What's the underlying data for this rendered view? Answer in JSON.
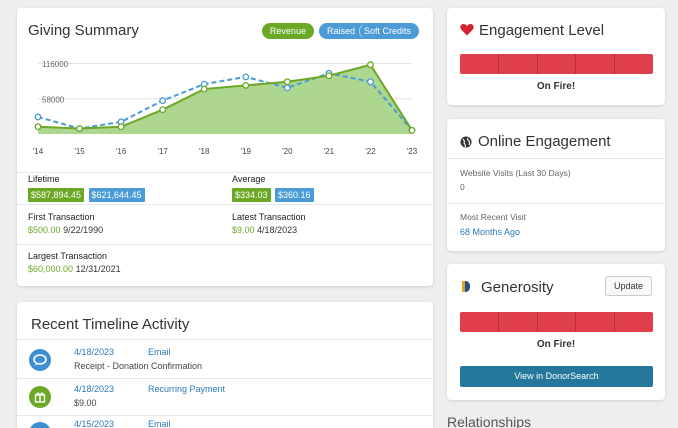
{
  "giving_summary": {
    "title": "Giving Summary",
    "legend": {
      "revenue": "Revenue",
      "raised": "Raised",
      "soft_credits": "Soft Credits"
    },
    "lifetime_label": "Lifetime",
    "lifetime_revenue": "$587,894.45",
    "lifetime_raised": "$621,644.45",
    "average_label": "Average",
    "average_revenue": "$334.03",
    "average_raised": "$360.16",
    "first_transaction_label": "First Transaction",
    "first_transaction_amount": "$500.00",
    "first_transaction_date": "9/22/1990",
    "latest_transaction_label": "Latest Transaction",
    "latest_transaction_amount": "$9.00",
    "latest_transaction_date": "4/18/2023",
    "largest_transaction_label": "Largest Transaction",
    "largest_transaction_amount": "$60,000.00",
    "largest_transaction_date": "12/31/2021"
  },
  "chart_data": {
    "type": "area",
    "categories": [
      "'14",
      "'15",
      "'16",
      "'17",
      "'18",
      "'19",
      "'20",
      "'21",
      "'22",
      "'23"
    ],
    "y_ticks": [
      58000,
      116000
    ],
    "y_tick_labels": [
      "58000",
      "116000"
    ],
    "ylim": [
      0,
      135000
    ],
    "series": [
      {
        "name": "Revenue",
        "values": [
          12000,
          9000,
          12000,
          40000,
          74000,
          80000,
          86000,
          96000,
          114000,
          6000
        ],
        "color": "#6aa826"
      },
      {
        "name": "Raised",
        "values": [
          28000,
          9000,
          20000,
          55000,
          82000,
          94000,
          76000,
          100000,
          86000,
          6000
        ],
        "color": "#4a9bd6"
      }
    ]
  },
  "timeline": {
    "title": "Recent Timeline Activity",
    "items": [
      {
        "date": "4/18/2023",
        "type": "Email",
        "detail": "Receipt - Donation Confirmation",
        "icon": "chat-bubble-icon",
        "color": "#3d8fd1"
      },
      {
        "date": "4/18/2023",
        "type": "Recurring Payment",
        "detail": "$9.00",
        "icon": "gift-icon",
        "color": "#6aa826"
      },
      {
        "date": "4/15/2023",
        "type": "Email",
        "detail": "",
        "icon": "chat-bubble-icon",
        "color": "#3d8fd1"
      }
    ]
  },
  "engagement": {
    "title": "Engagement Level",
    "status": "On Fire!"
  },
  "online": {
    "title": "Online Engagement",
    "visits_label": "Website Visits (Last 30 Days)",
    "visits_value": "0",
    "recent_visit_label": "Most Recent Visit",
    "recent_visit_value": "68 Months Ago"
  },
  "generosity": {
    "title": "Generosity",
    "update_label": "Update",
    "status": "On Fire!",
    "donorsearch_label": "View in DonorSearch"
  },
  "relationships": {
    "title": "Relationships"
  }
}
